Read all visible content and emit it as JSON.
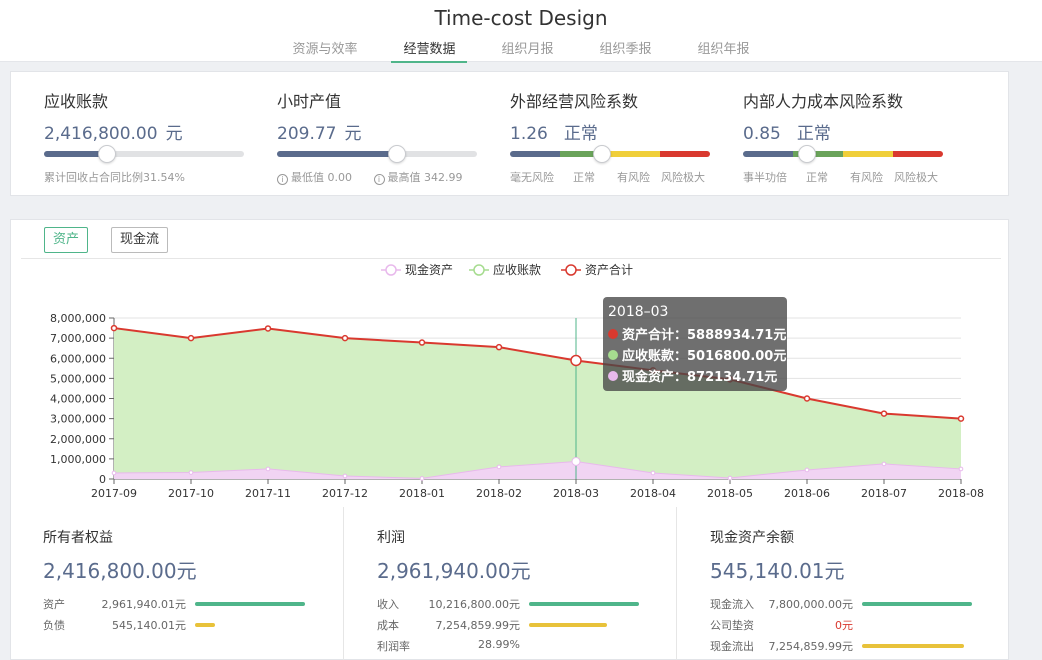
{
  "app": {
    "title": "Time-cost Design",
    "tabs": [
      {
        "label": "资源与效率",
        "active": false
      },
      {
        "label": "经营数据",
        "active": true
      },
      {
        "label": "组织月报",
        "active": false
      },
      {
        "label": "组织季报",
        "active": false
      },
      {
        "label": "组织年报",
        "active": false
      }
    ]
  },
  "kpis": {
    "receivable": {
      "title": "应收账款",
      "value": "2,416,800.00",
      "unit": "元",
      "progress_percent": 31.54,
      "note": "累计回收占合同比例31.54%"
    },
    "hourly": {
      "title": "小时产值",
      "value": "209.77",
      "unit": "元",
      "level_fraction": 0.6,
      "min_label": "最低值 0.00",
      "max_label": "最高值 342.99"
    },
    "external_risk": {
      "title": "外部经营风险系数",
      "value": "1.26",
      "status": "正常",
      "level_fraction": 0.46,
      "segments": [
        {
          "label": "毫无风险",
          "color": "#5a6b8c"
        },
        {
          "label": "正常",
          "color": "#6aa35a"
        },
        {
          "label": "有风险",
          "color": "#f0cf3a"
        },
        {
          "label": "风险极大",
          "color": "#d9392f"
        }
      ]
    },
    "internal_risk": {
      "title": "内部人力成本风险系数",
      "value": "0.85",
      "status": "正常",
      "level_fraction": 0.32,
      "segments": [
        {
          "label": "事半功倍",
          "color": "#5a6b8c"
        },
        {
          "label": "正常",
          "color": "#6aa35a"
        },
        {
          "label": "有风险",
          "color": "#f0cf3a"
        },
        {
          "label": "风险极大",
          "color": "#d9392f"
        }
      ]
    }
  },
  "chart_toggle": {
    "assets_label": "资产",
    "cashflow_label": "现金流"
  },
  "chart_data": {
    "type": "area",
    "x": [
      "2017-09",
      "2017-10",
      "2017-11",
      "2017-12",
      "2018-01",
      "2018-02",
      "2018-03",
      "2018-04",
      "2018-05",
      "2018-06",
      "2018-07",
      "2018-08"
    ],
    "ylim": [
      0,
      8000000
    ],
    "yticks": [
      "0",
      "1,000,000",
      "2,000,000",
      "3,000,000",
      "4,000,000",
      "5,000,000",
      "6,000,000",
      "7,000,000",
      "8,000,000"
    ],
    "grid": true,
    "legend_position": "top-center",
    "series": [
      {
        "name": "现金资产",
        "color": "#e8b9ec",
        "fill": "#f1d4f3",
        "values": [
          300000,
          320000,
          500000,
          150000,
          30000,
          600000,
          872134.71,
          300000,
          50000,
          450000,
          750000,
          500000
        ]
      },
      {
        "name": "应收账款",
        "color": "#a6dc8f",
        "fill": "#d3efc4",
        "values": [
          7200000,
          6680000,
          6980000,
          6850000,
          6750000,
          5950000,
          5016800,
          5550000,
          5150000,
          3600000,
          2500000,
          2500000
        ]
      },
      {
        "name": "资产合计",
        "color": "#d9392f",
        "values": [
          7500000,
          7000000,
          7480000,
          7000000,
          6780000,
          6550000,
          5888934.71,
          5400000,
          4950000,
          4000000,
          3250000,
          3000000
        ]
      }
    ],
    "tooltip": {
      "index": 6,
      "title": "2018–03",
      "rows": [
        {
          "label": "资产合计：5888934.71元",
          "color": "#d9392f"
        },
        {
          "label": "应收账款：5016800.00元",
          "color": "#a6dc8f"
        },
        {
          "label": "现金资产：872134.71元",
          "color": "#e8b9ec"
        }
      ]
    }
  },
  "summary": [
    {
      "title": "所有者权益",
      "value": "2,416,800.00元",
      "rows": [
        {
          "label": "资产",
          "value": "2,961,940.01元",
          "bar_color": "#4fb58a",
          "bar_fraction": 1.0
        },
        {
          "label": "负债",
          "value": "545,140.01元",
          "bar_color": "#e8c23a",
          "bar_fraction": 0.18
        }
      ]
    },
    {
      "title": "利润",
      "value": "2,961,940.00元",
      "rows": [
        {
          "label": "收入",
          "value": "10,216,800.00元",
          "bar_color": "#4fb58a",
          "bar_fraction": 1.0
        },
        {
          "label": "成本",
          "value": "7,254,859.99元",
          "bar_color": "#e8c23a",
          "bar_fraction": 0.71
        },
        {
          "label": "利润率",
          "value": "28.99%",
          "bar_color": "",
          "bar_fraction": 0
        }
      ]
    },
    {
      "title": "现金资产余额",
      "value": "545,140.01元",
      "rows": [
        {
          "label": "现金流入",
          "value": "7,800,000.00元",
          "bar_color": "#4fb58a",
          "bar_fraction": 1.0
        },
        {
          "label": "公司垫资",
          "value": "0元",
          "bar_color": "",
          "bar_fraction": 0,
          "red": true
        },
        {
          "label": "现金流出",
          "value": "7,254,859.99元",
          "bar_color": "#e8c23a",
          "bar_fraction": 0.93
        }
      ]
    }
  ]
}
